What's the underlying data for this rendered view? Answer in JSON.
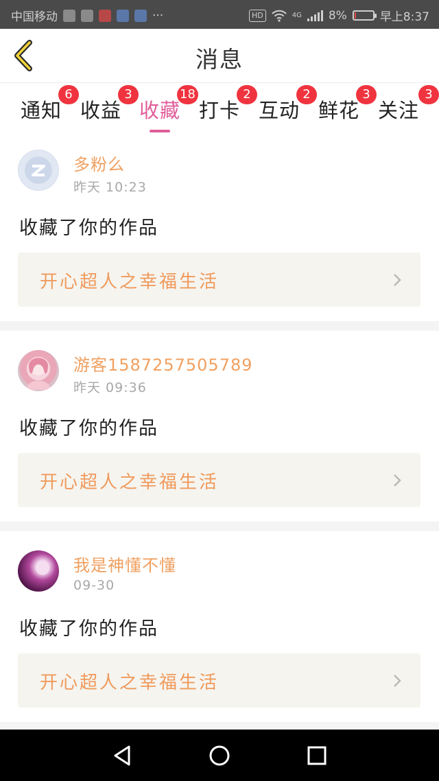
{
  "status_bar": {
    "carrier": "中国移动",
    "hd": "HD",
    "network": "4G",
    "battery": "8%",
    "time": "早上8:37",
    "battery_level": 0.08
  },
  "header": {
    "title": "消息",
    "back_icon": "chevron-left-icon"
  },
  "tabs": [
    {
      "label": "通知",
      "badge": "6"
    },
    {
      "label": "收益",
      "badge": "3"
    },
    {
      "label": "收藏",
      "badge": "18",
      "active": true
    },
    {
      "label": "打卡",
      "badge": "2"
    },
    {
      "label": "互动",
      "badge": "2"
    },
    {
      "label": "鲜花",
      "badge": "3"
    },
    {
      "label": "关注",
      "badge": "3"
    }
  ],
  "items": [
    {
      "username": "多粉么",
      "time": "昨天  10:23",
      "action": "收藏了你的作品",
      "work_title": "开心超人之幸福生活"
    },
    {
      "username": "游客1587257505789",
      "time": "昨天  09:36",
      "action": "收藏了你的作品",
      "work_title": "开心超人之幸福生活"
    },
    {
      "username": "我是神懂不懂",
      "time": "09-30",
      "action": "收藏了你的作品",
      "work_title": "开心超人之幸福生活"
    }
  ],
  "colors": {
    "accent": "#e05d9a",
    "badge": "#f0343f",
    "name": "#f0a060",
    "work_title": "#f09a5c"
  },
  "nav": {
    "back": "triangle-back-icon",
    "home": "circle-home-icon",
    "recents": "square-recents-icon"
  }
}
